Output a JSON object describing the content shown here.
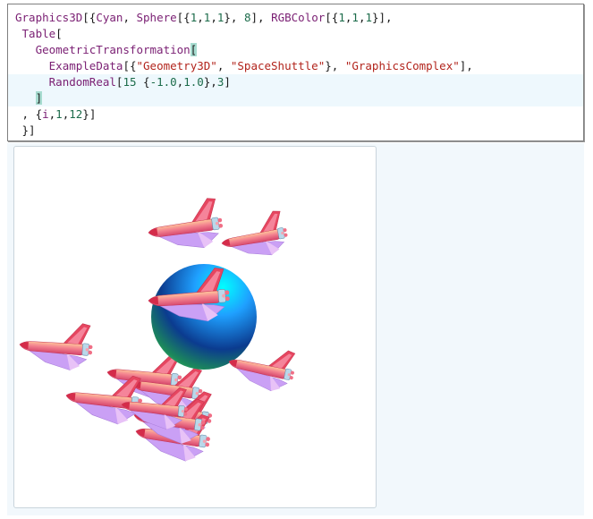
{
  "input_cell": {
    "lines": [
      [
        {
          "t": "Graphics3D",
          "c": "fn"
        },
        {
          "t": "[{",
          "c": "plain"
        },
        {
          "t": "Cyan",
          "c": "sym"
        },
        {
          "t": ", ",
          "c": "plain"
        },
        {
          "t": "Sphere",
          "c": "fn"
        },
        {
          "t": "[{",
          "c": "plain"
        },
        {
          "t": "1",
          "c": "num"
        },
        {
          "t": ",",
          "c": "plain"
        },
        {
          "t": "1",
          "c": "num"
        },
        {
          "t": ",",
          "c": "plain"
        },
        {
          "t": "1",
          "c": "num"
        },
        {
          "t": "}, ",
          "c": "plain"
        },
        {
          "t": "8",
          "c": "num"
        },
        {
          "t": "], ",
          "c": "plain"
        },
        {
          "t": "RGBColor",
          "c": "fn"
        },
        {
          "t": "[{",
          "c": "plain"
        },
        {
          "t": "1",
          "c": "num"
        },
        {
          "t": ",",
          "c": "plain"
        },
        {
          "t": "1",
          "c": "num"
        },
        {
          "t": ",",
          "c": "plain"
        },
        {
          "t": "1",
          "c": "num"
        },
        {
          "t": "}],",
          "c": "plain"
        }
      ],
      [
        {
          "t": " ",
          "c": "plain"
        },
        {
          "t": "Table",
          "c": "fn"
        },
        {
          "t": "[",
          "c": "plain"
        }
      ],
      [
        {
          "t": "   ",
          "c": "plain"
        },
        {
          "t": "GeometricTransformation",
          "c": "fn"
        },
        {
          "t": "[",
          "c": "bracket"
        }
      ],
      [
        {
          "t": "     ",
          "c": "plain"
        },
        {
          "t": "ExampleData",
          "c": "fn"
        },
        {
          "t": "[{",
          "c": "plain"
        },
        {
          "t": "\"Geometry3D\"",
          "c": "str"
        },
        {
          "t": ", ",
          "c": "plain"
        },
        {
          "t": "\"SpaceShuttle\"",
          "c": "str"
        },
        {
          "t": "}, ",
          "c": "plain"
        },
        {
          "t": "\"GraphicsComplex\"",
          "c": "str"
        },
        {
          "t": "],",
          "c": "plain"
        }
      ],
      [
        {
          "t": "     ",
          "c": "plain"
        },
        {
          "t": "RandomReal",
          "c": "fn"
        },
        {
          "t": "[",
          "c": "plain"
        },
        {
          "t": "15",
          "c": "num"
        },
        {
          "t": " {",
          "c": "plain"
        },
        {
          "t": "-1.0",
          "c": "num"
        },
        {
          "t": ",",
          "c": "plain"
        },
        {
          "t": "1.0",
          "c": "num"
        },
        {
          "t": "},",
          "c": "plain"
        },
        {
          "t": "3",
          "c": "num"
        },
        {
          "t": "]",
          "c": "plain"
        }
      ],
      [
        {
          "t": "   ",
          "c": "plain"
        },
        {
          "t": "]",
          "c": "bracket"
        }
      ],
      [
        {
          "t": " , {",
          "c": "plain"
        },
        {
          "t": "i",
          "c": "sym"
        },
        {
          "t": ",",
          "c": "plain"
        },
        {
          "t": "1",
          "c": "num"
        },
        {
          "t": ",",
          "c": "plain"
        },
        {
          "t": "12",
          "c": "num"
        },
        {
          "t": "}]",
          "c": "plain"
        }
      ],
      [
        {
          "t": " }]",
          "c": "plain"
        }
      ]
    ],
    "highlighted_lines": [
      4,
      5
    ]
  },
  "output_graphic": {
    "sphere_colors": [
      "#00ffff",
      "#1fa0ff",
      "#0b3b8f",
      "#1c8a5a",
      "#62d08a"
    ],
    "shuttle_colors": {
      "body": "#f06f86",
      "body_light": "#ffb48a",
      "wing": "#c48bf0",
      "tail": "#e8425e",
      "nose": "#d0263f",
      "engine": "#b7d6e6"
    },
    "shuttle_count": 12
  }
}
